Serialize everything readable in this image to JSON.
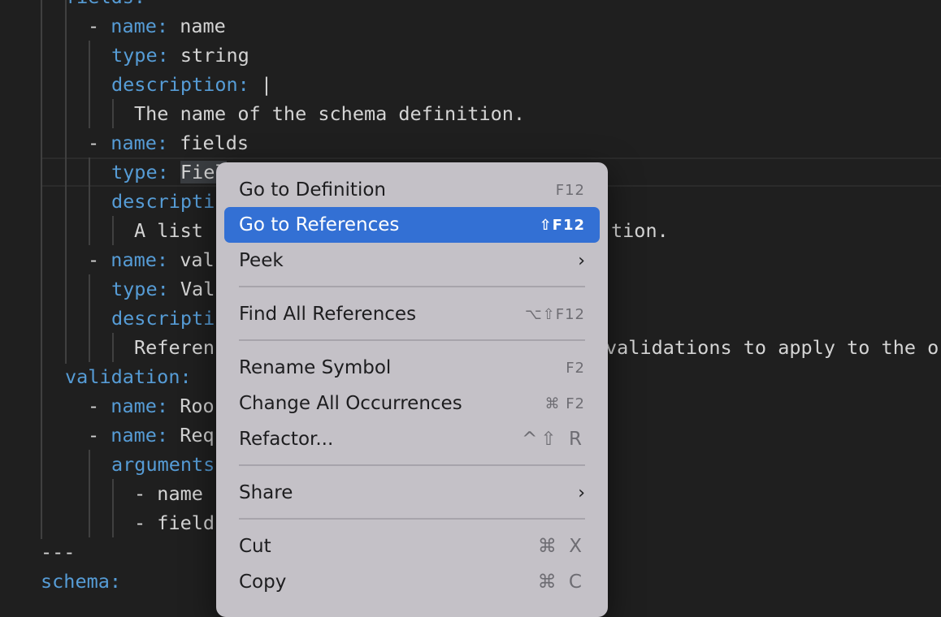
{
  "editor": {
    "lines": [
      {
        "key": "fields:"
      },
      {
        "dash": "- ",
        "key": "name:",
        "val": " name"
      },
      {
        "key": "type:",
        "val": " string"
      },
      {
        "key": "description:",
        "val": " |"
      },
      {
        "val": "The name of the schema definition."
      },
      {
        "dash": "- ",
        "key": "name:",
        "val": " fields"
      },
      {
        "key": "type:",
        "val": " ",
        "sel": "Fiel"
      },
      {
        "key": "descripti"
      },
      {
        "val": "A list",
        "tail": "tion."
      },
      {
        "dash": "- ",
        "key": "name:",
        "val": " val"
      },
      {
        "key": "type:",
        "val": " Val"
      },
      {
        "key": "descripti"
      },
      {
        "val": "Referen",
        "tail": "validations to apply to the o"
      },
      {
        "key": "validation:"
      },
      {
        "dash": "- ",
        "key": "name:",
        "val": " Roo"
      },
      {
        "dash": "- ",
        "key": "name:",
        "val": " Req"
      },
      {
        "key": "arguments"
      },
      {
        "val": "- name"
      },
      {
        "val": "- field"
      },
      {
        "val": "---"
      },
      {
        "key": "schema:"
      }
    ]
  },
  "context_menu": {
    "items": [
      {
        "label": "Go to Definition",
        "shortcut": "F12"
      },
      {
        "label": "Go to References",
        "shortcut": "⇧F12"
      },
      {
        "label": "Peek",
        "shortcut": "›"
      },
      {
        "label": "Find All References",
        "shortcut": "⌥⇧F12"
      },
      {
        "label": "Rename Symbol",
        "shortcut": "F2"
      },
      {
        "label": "Change All Occurrences",
        "shortcut": "⌘ F2"
      },
      {
        "label": "Refactor...",
        "shortcut": "^⇧ R"
      },
      {
        "label": "Share",
        "shortcut": "›"
      },
      {
        "label": "Cut",
        "shortcut": "⌘ X"
      },
      {
        "label": "Copy",
        "shortcut": "⌘ C"
      }
    ]
  },
  "colors": {
    "editor_bg": "#1f1f1f",
    "key": "#569cd6",
    "text": "#d4d4d4",
    "menu_bg": "#c4c1c7",
    "menu_highlight": "#3370d4"
  }
}
